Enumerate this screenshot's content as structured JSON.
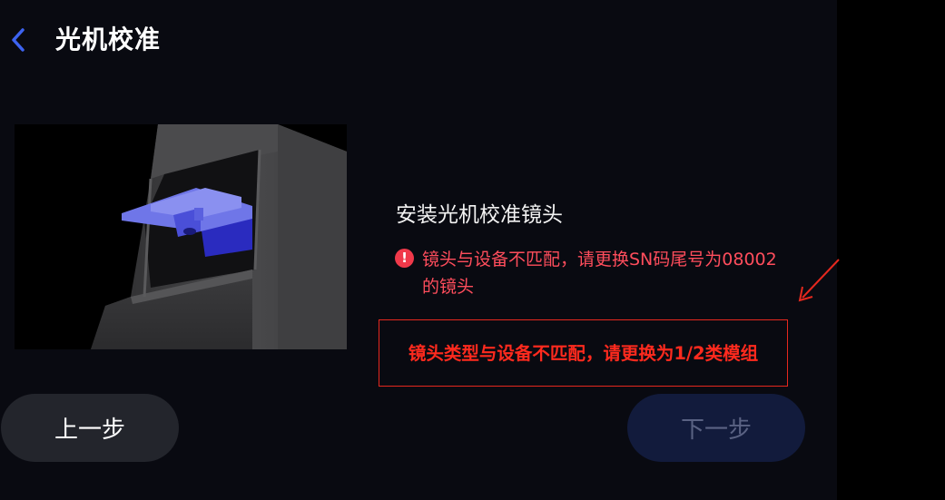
{
  "header": {
    "back_icon": "chevron-left-icon",
    "title": "光机校准"
  },
  "step": {
    "title": "安装光机校准镜头"
  },
  "warning": {
    "icon": "exclamation-circle-icon",
    "text": "镜头与设备不匹配，请更换SN码尾号为08002的镜头"
  },
  "annotation": {
    "text": "镜头类型与设备不匹配，请更换为1/2类模组"
  },
  "buttons": {
    "prev": "上一步",
    "next": "下一步"
  },
  "colors": {
    "background": "#090a11",
    "accent_blue": "#3d63f0",
    "error": "#ff4d5c",
    "annotation_red": "#e5281e",
    "disabled_button": "#121b3c"
  }
}
